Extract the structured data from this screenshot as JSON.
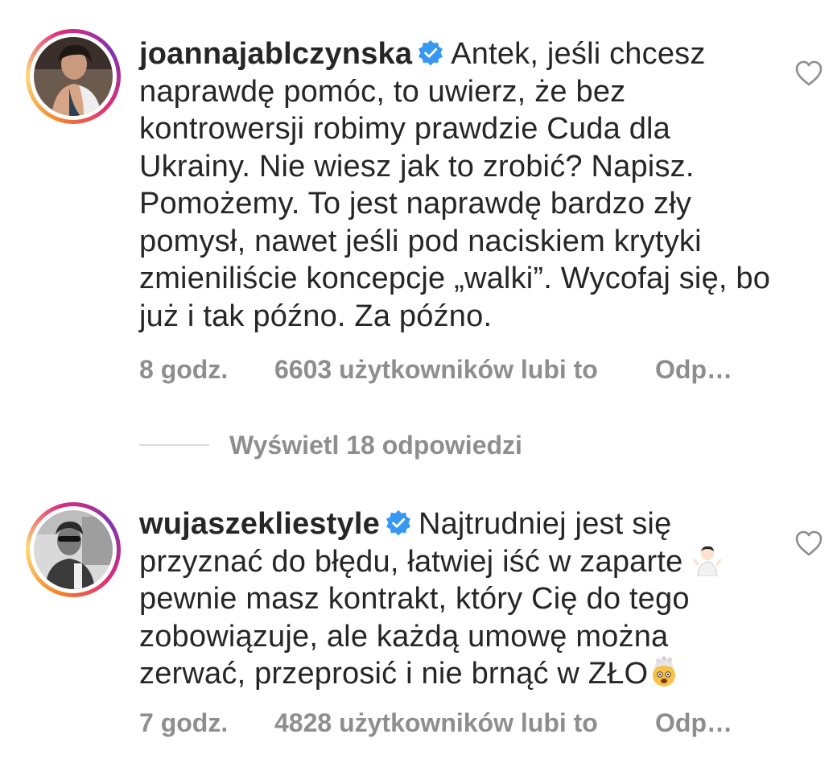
{
  "comments": [
    {
      "username": "joannajablczynska",
      "verified": true,
      "text": "Antek, jeśli chcesz naprawdę pomóc, to uwierz, że bez kontrowersji robimy prawdzie Cuda dla Ukrainy. Nie wiesz jak to zrobić? Napisz. Pomożemy. To jest naprawdę bardzo zły pomysł, nawet jeśli pod naciskiem krytyki zmieniliście koncepcje „walki”. Wycofaj się, bo już i tak późno. Za późno.",
      "time": "8 godz.",
      "likes": "6603 użytkowników lubi to",
      "reply": "Odp…"
    },
    {
      "username": "wujaszekliestyle",
      "verified": true,
      "text_part1": "Najtrudniej jest się przyznać do błędu, łatwiej iść w zaparte",
      "text_part2": "pewnie masz kontrakt, który Cię do tego zobowiązuje, ale każdą umowę można zerwać, przeprosić i nie brnąć w ZŁO",
      "time": "7 godz.",
      "likes": "4828 użytkowników lubi to",
      "reply": "Odp…"
    }
  ],
  "view_replies": "Wyświetl 18 odpowiedzi",
  "icons": {
    "verified": "verified-badge-icon",
    "heart": "heart-outline-icon",
    "shrug": "shrug-emoji-icon",
    "exploding_head": "exploding-head-emoji-icon"
  },
  "colors": {
    "text": "#262626",
    "secondary": "#8e8e8e",
    "verified_blue": "#3897f0",
    "divider": "#dbdbdb"
  }
}
